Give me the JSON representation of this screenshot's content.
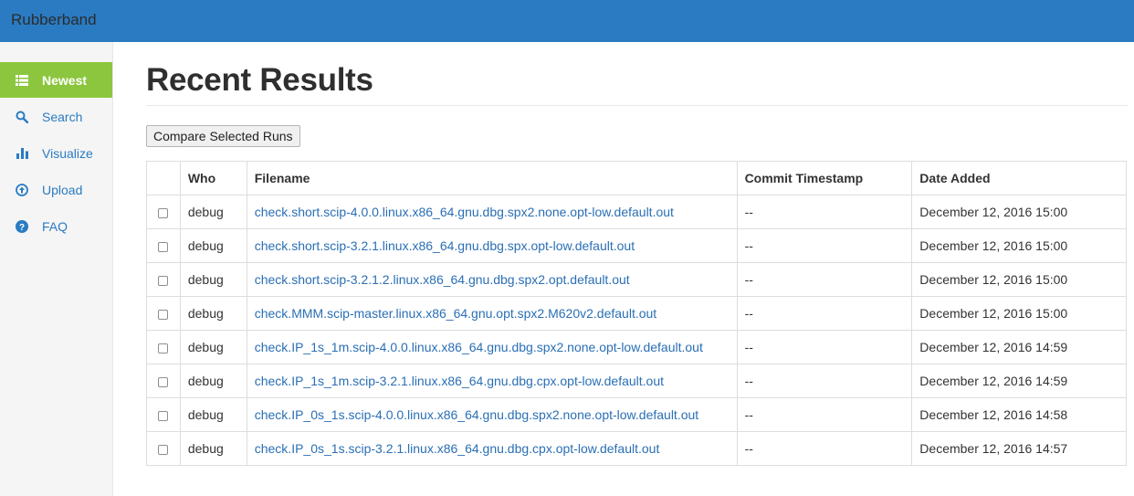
{
  "app": {
    "title": "Rubberband"
  },
  "sidebar": {
    "items": [
      {
        "label": "Newest",
        "icon": "list-icon",
        "active": true
      },
      {
        "label": "Search",
        "icon": "search-icon",
        "active": false
      },
      {
        "label": "Visualize",
        "icon": "bar-chart-icon",
        "active": false
      },
      {
        "label": "Upload",
        "icon": "upload-icon",
        "active": false
      },
      {
        "label": "FAQ",
        "icon": "question-icon",
        "active": false
      }
    ]
  },
  "main": {
    "title": "Recent Results",
    "compare_button": "Compare Selected Runs",
    "table": {
      "headers": [
        "",
        "Who",
        "Filename",
        "Commit Timestamp",
        "Date Added"
      ],
      "rows": [
        {
          "who": "debug",
          "filename": "check.short.scip-4.0.0.linux.x86_64.gnu.dbg.spx2.none.opt-low.default.out",
          "commit": "--",
          "date": "December 12, 2016 15:00"
        },
        {
          "who": "debug",
          "filename": "check.short.scip-3.2.1.linux.x86_64.gnu.dbg.spx.opt-low.default.out",
          "commit": "--",
          "date": "December 12, 2016 15:00"
        },
        {
          "who": "debug",
          "filename": "check.short.scip-3.2.1.2.linux.x86_64.gnu.dbg.spx2.opt.default.out",
          "commit": "--",
          "date": "December 12, 2016 15:00"
        },
        {
          "who": "debug",
          "filename": "check.MMM.scip-master.linux.x86_64.gnu.opt.spx2.M620v2.default.out",
          "commit": "--",
          "date": "December 12, 2016 15:00"
        },
        {
          "who": "debug",
          "filename": "check.IP_1s_1m.scip-4.0.0.linux.x86_64.gnu.dbg.spx2.none.opt-low.default.out",
          "commit": "--",
          "date": "December 12, 2016 14:59"
        },
        {
          "who": "debug",
          "filename": "check.IP_1s_1m.scip-3.2.1.linux.x86_64.gnu.dbg.cpx.opt-low.default.out",
          "commit": "--",
          "date": "December 12, 2016 14:59"
        },
        {
          "who": "debug",
          "filename": "check.IP_0s_1s.scip-4.0.0.linux.x86_64.gnu.dbg.spx2.none.opt-low.default.out",
          "commit": "--",
          "date": "December 12, 2016 14:58"
        },
        {
          "who": "debug",
          "filename": "check.IP_0s_1s.scip-3.2.1.linux.x86_64.gnu.dbg.cpx.opt-low.default.out",
          "commit": "--",
          "date": "December 12, 2016 14:57"
        }
      ]
    }
  },
  "colors": {
    "header": "#2a7bc2",
    "active_nav": "#8cc63f",
    "link": "#2a6fb5"
  }
}
